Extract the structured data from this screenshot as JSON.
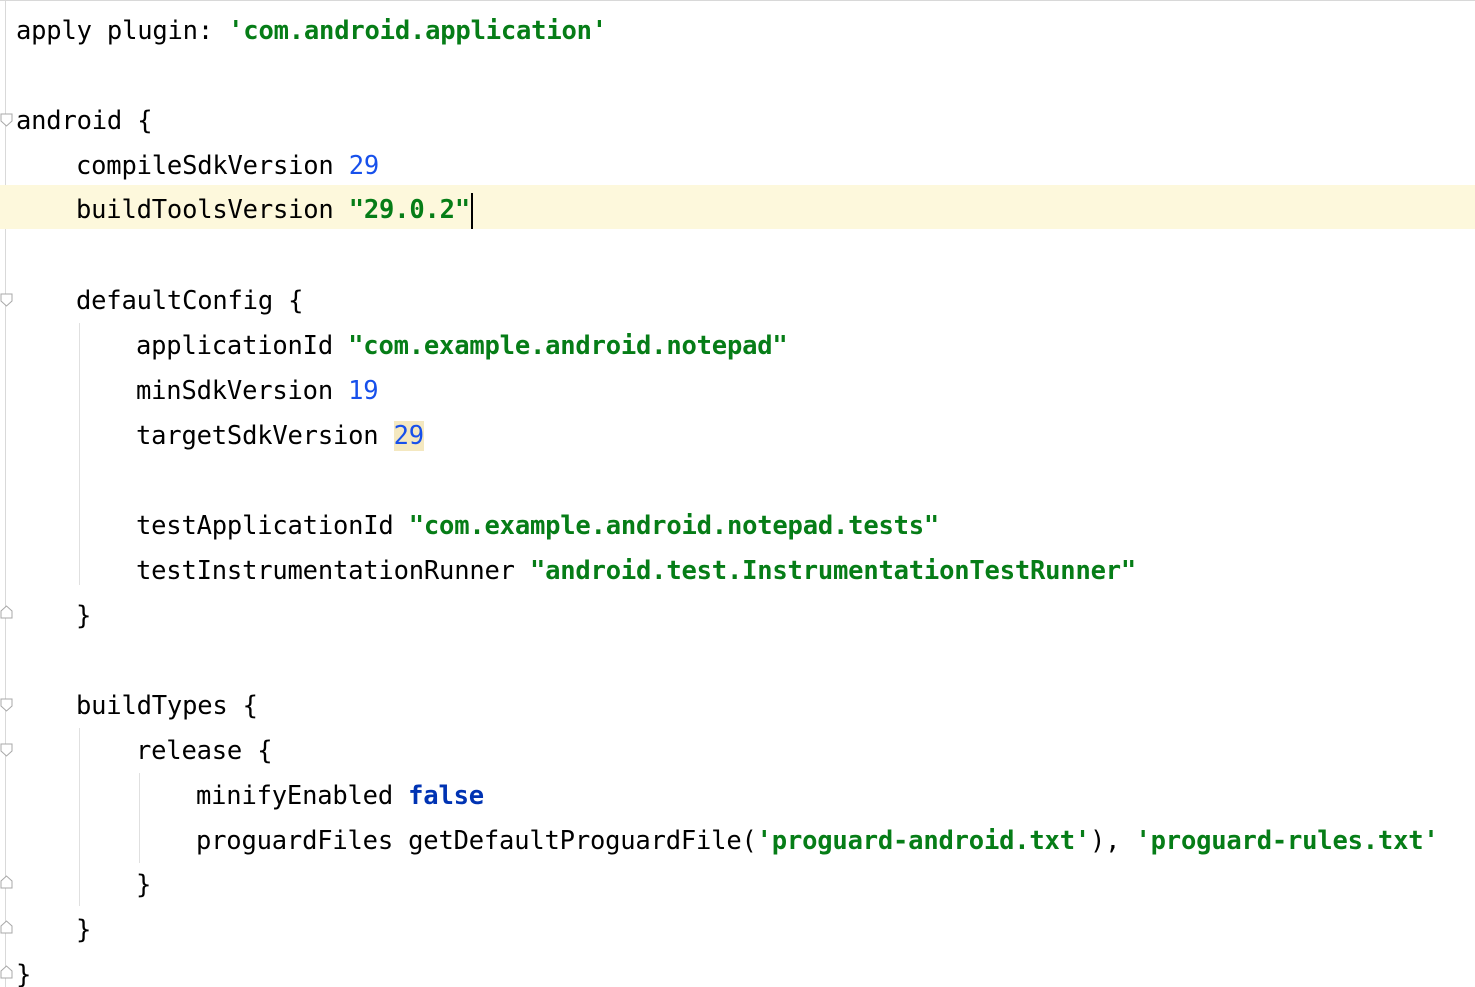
{
  "editor": {
    "lines": [
      {
        "text": "apply plugin: 'com.android.application'"
      },
      {
        "text": "android {"
      },
      {
        "key": "compileSdkVersion",
        "value": "29"
      },
      {
        "key": "buildToolsVersion",
        "value": "\"29.0.2\""
      },
      {
        "text": "defaultConfig {"
      },
      {
        "key": "applicationId",
        "value": "\"com.example.android.notepad\""
      },
      {
        "key": "minSdkVersion",
        "value": "19"
      },
      {
        "key": "targetSdkVersion",
        "value": "29"
      },
      {
        "key": "testApplicationId",
        "value": "\"com.example.android.notepad.tests\""
      },
      {
        "key": "testInstrumentationRunner",
        "value": "\"android.test.InstrumentationTestRunner\""
      },
      {
        "text": "}"
      },
      {
        "text": "buildTypes {"
      },
      {
        "text": "release {"
      },
      {
        "key": "minifyEnabled",
        "value": "false"
      },
      {
        "key": "proguardFiles",
        "call": "getDefaultProguardFile(",
        "arg1": "'proguard-android.txt'",
        "sep": "), ",
        "arg2": "'proguard-rules.txt'"
      },
      {
        "text": "}"
      },
      {
        "text": "}"
      },
      {
        "text": "}"
      }
    ],
    "apply_prefix": "apply plugin: ",
    "apply_value": "'com.android.application'",
    "colors": {
      "string": "#067d17",
      "number": "#1750eb",
      "keyword": "#0033b3",
      "caret_row": "#fdf8dc",
      "match_highlight": "#f4e8c0"
    }
  }
}
